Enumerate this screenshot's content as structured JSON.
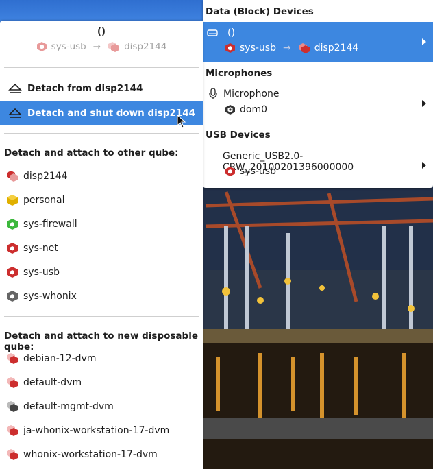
{
  "left_menu": {
    "header": {
      "title": "()",
      "source_qube": "sys-usb",
      "arrow": "→",
      "target_qube": "disp2144"
    },
    "actions": [
      {
        "label": "Detach from disp2144",
        "icon": "eject-icon"
      },
      {
        "label": "Detach and shut down disp2144",
        "icon": "eject-icon",
        "highlighted": true
      }
    ],
    "attach_other_title": "Detach and attach to other qube:",
    "other_qubes": [
      {
        "label": "disp2144",
        "color": "#cc2e2e",
        "kind": "disposable"
      },
      {
        "label": "personal",
        "color": "#e0b000",
        "kind": "app"
      },
      {
        "label": "sys-firewall",
        "color": "#3cb83c",
        "kind": "app"
      },
      {
        "label": "sys-net",
        "color": "#cc2e2e",
        "kind": "app"
      },
      {
        "label": "sys-usb",
        "color": "#cc2e2e",
        "kind": "app"
      },
      {
        "label": "sys-whonix",
        "color": "#666666",
        "kind": "app"
      }
    ],
    "attach_new_title": "Detach and attach to new disposable qube:",
    "disposable_templates": [
      {
        "label": "debian-12-dvm",
        "color": "#cc2e2e"
      },
      {
        "label": "default-dvm",
        "color": "#cc2e2e"
      },
      {
        "label": "default-mgmt-dvm",
        "color": "#444444"
      },
      {
        "label": "ja-whonix-workstation-17-dvm",
        "color": "#cc2e2e"
      },
      {
        "label": "whonix-workstation-17-dvm",
        "color": "#cc2e2e"
      }
    ]
  },
  "right_panel": {
    "block_title": "Data (Block) Devices",
    "block_device": {
      "name": "()",
      "from": "sys-usb",
      "arrow": "→",
      "to": "disp2144",
      "icon": "drive-icon"
    },
    "mic_title": "Microphones",
    "mic_device": {
      "name": "Microphone",
      "qube": "dom0",
      "icon": "microphone-icon"
    },
    "usb_title": "USB Devices",
    "usb_device": {
      "name": "Generic_USB2.0-CRW_20100201396000000",
      "qube": "sys-usb"
    }
  },
  "colors": {
    "highlight": "#3d87e0",
    "red_qube": "#cc2e2e",
    "yellow_qube": "#e0b000",
    "green_qube": "#3cb83c",
    "gray_qube": "#666666"
  }
}
